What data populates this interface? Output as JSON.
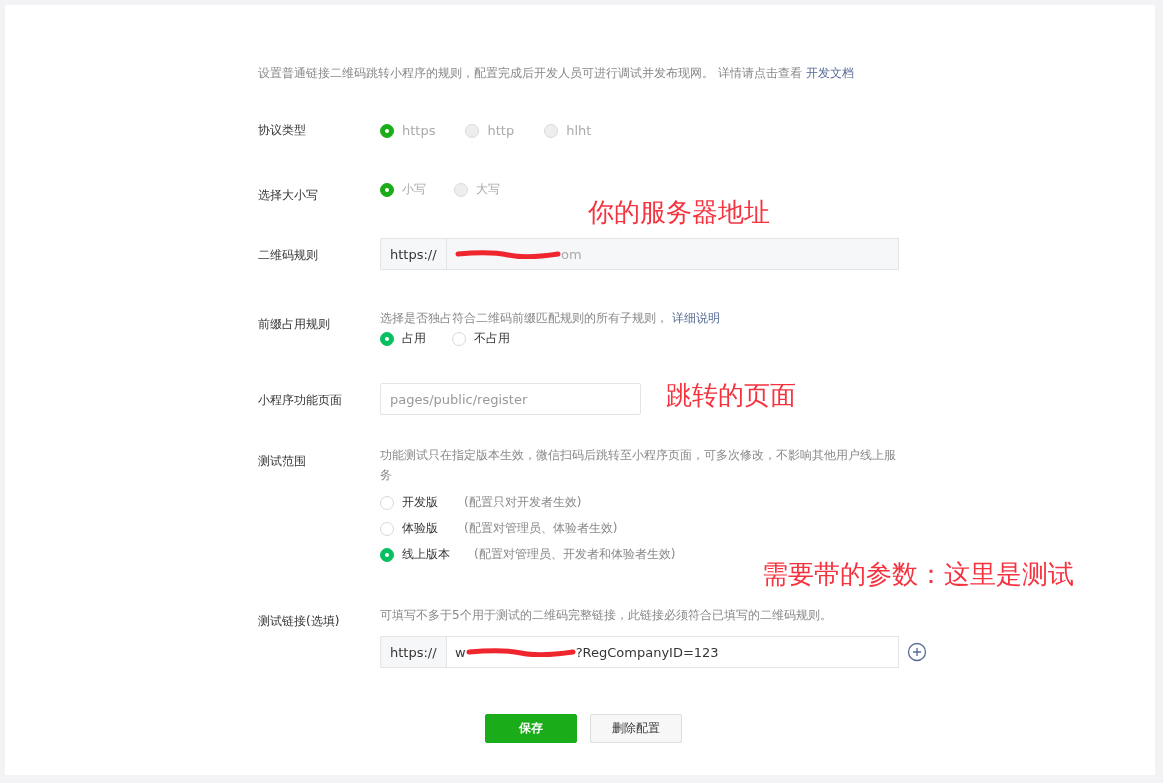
{
  "intro": {
    "text": "设置普通链接二维码跳转小程序的规则，配置完成后开发人员可进行调试并发布现网。 详情请点击查看",
    "link": "开发文档"
  },
  "protocol": {
    "label": "协议类型",
    "options": [
      {
        "label": "https",
        "selected": true
      },
      {
        "label": "http",
        "selected": false
      },
      {
        "label": "hlht",
        "selected": false
      }
    ]
  },
  "case": {
    "label": "选择大小写",
    "options": [
      {
        "label": "小写",
        "selected": true
      },
      {
        "label": "大写",
        "selected": false
      }
    ]
  },
  "qr_rule": {
    "label": "二维码规则",
    "prefix": "https://",
    "value_tail": "om"
  },
  "prefix_rule": {
    "label": "前缀占用规则",
    "hint": "选择是否独占符合二维码前缀匹配规则的所有子规则，",
    "link": "详细说明",
    "options": [
      {
        "label": "占用",
        "selected": true
      },
      {
        "label": "不占用",
        "selected": false
      }
    ]
  },
  "page": {
    "label": "小程序功能页面",
    "placeholder": "pages/public/register"
  },
  "scope": {
    "label": "测试范围",
    "hint": "功能测试只在指定版本生效，微信扫码后跳转至小程序页面，可多次修改，不影响其他用户线上服务",
    "options": [
      {
        "label": "开发版",
        "note": "(配置只对开发者生效)",
        "selected": false
      },
      {
        "label": "体验版",
        "note": "(配置对管理员、体验者生效)",
        "selected": false
      },
      {
        "label": "线上版本",
        "note": "(配置对管理员、开发者和体验者生效)",
        "selected": true
      }
    ]
  },
  "test_link": {
    "label": "测试链接(选填)",
    "hint": "可填写不多于5个用于测试的二维码完整链接，此链接必须符合已填写的二维码规则。",
    "prefix": "https://",
    "value_head": "w",
    "value_tail": "?RegCompanyID=123"
  },
  "buttons": [
    {
      "label": "保存",
      "kind": "primary"
    },
    {
      "label": "删除配置",
      "kind": "default"
    }
  ],
  "annotations": [
    "你的服务器地址",
    "跳转的页面",
    "需要带的参数：这里是测试"
  ]
}
